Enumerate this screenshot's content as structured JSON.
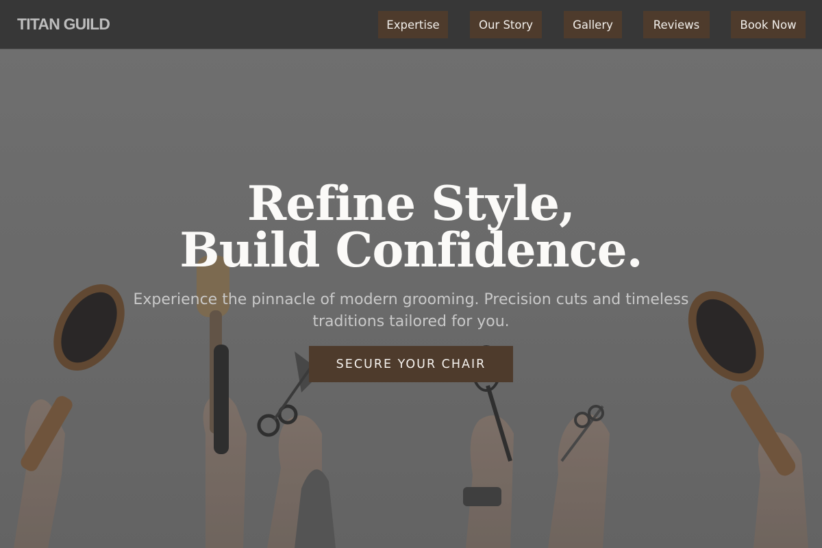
{
  "header": {
    "brand": "TITAN GUILD",
    "nav": [
      "Expertise",
      "Our Story",
      "Gallery",
      "Reviews",
      "Book Now"
    ]
  },
  "hero": {
    "headline_line1": "Refine Style,",
    "headline_line2": "Build Confidence.",
    "subtitle_line1": "Experience the pinnacle of modern grooming. Precision cuts and timeless",
    "subtitle_line2": "traditions tailored for you.",
    "cta": "SECURE YOUR CHAIR",
    "image_description_icons": [
      "hairbrush-icon",
      "scissors-icon",
      "round-brush-icon",
      "whisk-icon",
      "hand-icon"
    ]
  },
  "colors": {
    "header_bg": "#373737",
    "accent_brown": "#4e3b2c",
    "hero_overlay": "#6f6f6f",
    "headline": "#fbfaf8",
    "subtitle": "#c9c9c9"
  }
}
